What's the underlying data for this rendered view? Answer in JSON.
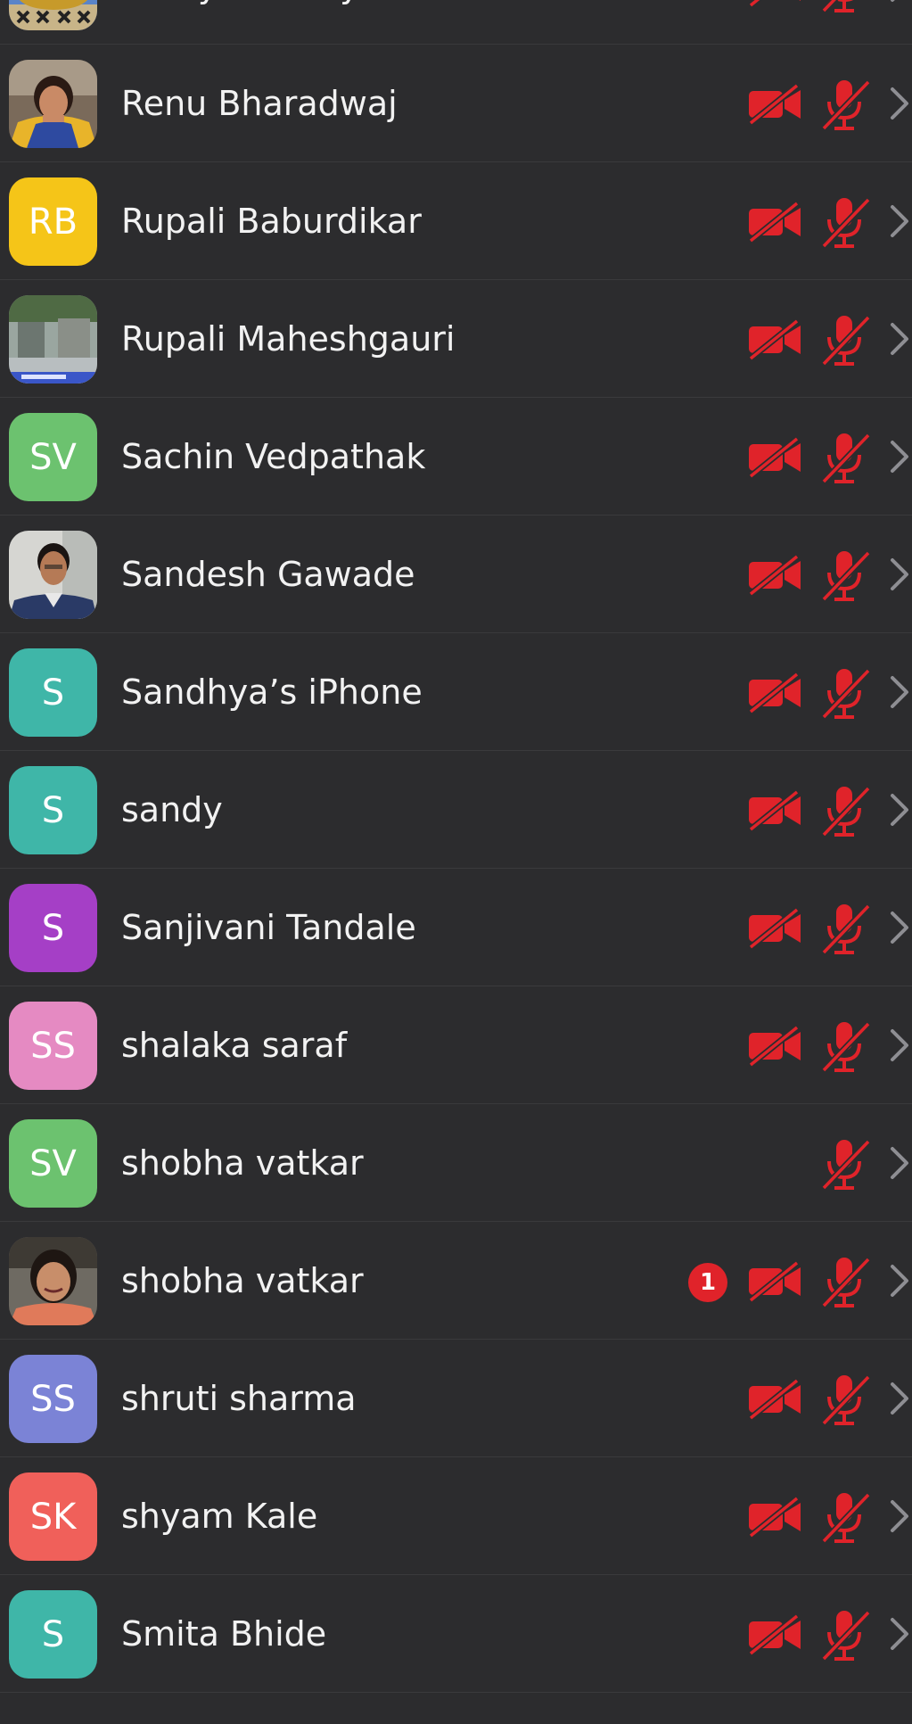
{
  "participants": [
    {
      "name": "Ramya Shetty",
      "avatar": {
        "type": "photo",
        "photo": "temple-dome"
      },
      "video_muted": true,
      "audio_muted": true
    },
    {
      "name": "Renu Bharadwaj",
      "avatar": {
        "type": "photo",
        "photo": "woman-portrait"
      },
      "video_muted": true,
      "audio_muted": true
    },
    {
      "name": "Rupali Baburdikar",
      "avatar": {
        "type": "initials",
        "initials": "RB",
        "color": "#f5c518"
      },
      "video_muted": true,
      "audio_muted": true
    },
    {
      "name": "Rupali Maheshgauri",
      "avatar": {
        "type": "photo",
        "photo": "street-scene"
      },
      "video_muted": true,
      "audio_muted": true
    },
    {
      "name": "Sachin Vedpathak",
      "avatar": {
        "type": "initials",
        "initials": "SV",
        "color": "#6cc26f"
      },
      "video_muted": true,
      "audio_muted": true
    },
    {
      "name": "Sandesh Gawade",
      "avatar": {
        "type": "photo",
        "photo": "man-portrait"
      },
      "video_muted": true,
      "audio_muted": true
    },
    {
      "name": "Sandhya’s iPhone",
      "avatar": {
        "type": "initials",
        "initials": "S",
        "color": "#3fb6a8"
      },
      "video_muted": true,
      "audio_muted": true
    },
    {
      "name": "sandy",
      "avatar": {
        "type": "initials",
        "initials": "S",
        "color": "#3fb6a8"
      },
      "video_muted": true,
      "audio_muted": true
    },
    {
      "name": "Sanjivani Tandale",
      "avatar": {
        "type": "initials",
        "initials": "S",
        "color": "#a53fc6"
      },
      "video_muted": true,
      "audio_muted": true
    },
    {
      "name": "shalaka saraf",
      "avatar": {
        "type": "initials",
        "initials": "SS",
        "color": "#e58ac2"
      },
      "video_muted": true,
      "audio_muted": true
    },
    {
      "name": "shobha vatkar",
      "avatar": {
        "type": "initials",
        "initials": "SV",
        "color": "#6cc26f"
      },
      "video_muted": false,
      "audio_muted": true
    },
    {
      "name": "shobha vatkar",
      "avatar": {
        "type": "photo",
        "photo": "woman-portrait-2"
      },
      "badge": "1",
      "video_muted": true,
      "audio_muted": true
    },
    {
      "name": "shruti sharma",
      "avatar": {
        "type": "initials",
        "initials": "SS",
        "color": "#7b83d6"
      },
      "video_muted": true,
      "audio_muted": true
    },
    {
      "name": "shyam Kale",
      "avatar": {
        "type": "initials",
        "initials": "SK",
        "color": "#f0605a"
      },
      "video_muted": true,
      "audio_muted": true
    },
    {
      "name": "Smita Bhide",
      "avatar": {
        "type": "initials",
        "initials": "S",
        "color": "#3fb6a8"
      },
      "video_muted": true,
      "audio_muted": true
    }
  ],
  "colors": {
    "background": "#2c2c2e",
    "separator": "#3a3a3c",
    "muted_red": "#e0232a",
    "chevron": "#8e8e93",
    "text": "#f2f2f2"
  },
  "icons": {
    "video": "video-off-icon",
    "audio": "mic-off-icon",
    "disclosure": "chevron-right-icon"
  }
}
